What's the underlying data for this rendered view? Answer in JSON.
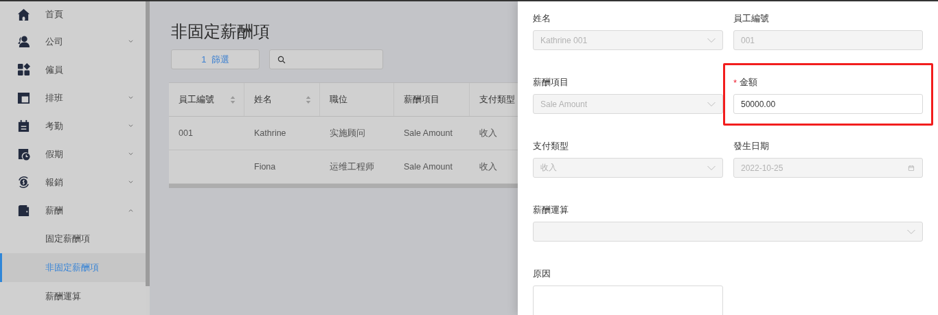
{
  "sidebar": {
    "items": [
      {
        "label": "首頁"
      },
      {
        "label": "公司",
        "expanded": false
      },
      {
        "label": "僱員"
      },
      {
        "label": "排班",
        "expanded": false
      },
      {
        "label": "考勤",
        "expanded": false
      },
      {
        "label": "假期",
        "expanded": false
      },
      {
        "label": "報銷",
        "expanded": false
      },
      {
        "label": "薪酬",
        "expanded": true,
        "children": [
          {
            "label": "固定薪酬項",
            "selected": false
          },
          {
            "label": "非固定薪酬項",
            "selected": true
          },
          {
            "label": "薪酬運算",
            "selected": false
          }
        ]
      }
    ]
  },
  "page": {
    "title": "非固定薪酬項",
    "filter_button": {
      "count": "1",
      "label": "篩選"
    }
  },
  "table": {
    "columns": [
      {
        "label": "員工編號",
        "sortable": true
      },
      {
        "label": "姓名",
        "sortable": true
      },
      {
        "label": "職位",
        "sortable": false
      },
      {
        "label": "薪酬項目",
        "sortable": false
      },
      {
        "label": "支付類型"
      }
    ],
    "rows": [
      [
        "001",
        "Kathrine",
        "实施顾问",
        "Sale Amount",
        "收入"
      ],
      [
        "",
        "Fiona",
        "运维工程师",
        "Sale Amount",
        "收入"
      ]
    ]
  },
  "form": {
    "fields": [
      {
        "label": "姓名",
        "kind": "select",
        "value": "Kathrine 001",
        "disabled": true,
        "highlighted": false,
        "wide": false
      },
      {
        "label": "員工編號",
        "kind": "input",
        "value": "001",
        "disabled": true,
        "highlighted": false,
        "wide": false
      },
      {
        "label": "薪酬項目",
        "kind": "select",
        "value": "Sale Amount",
        "disabled": true,
        "highlighted": false,
        "wide": false
      },
      {
        "label": "金額",
        "required_mark": "*",
        "kind": "input",
        "value": "50000.00",
        "disabled": false,
        "highlighted": true,
        "wide": false
      },
      {
        "label": "支付類型",
        "kind": "select",
        "value": "收入",
        "disabled": true,
        "highlighted": false,
        "wide": false
      },
      {
        "label": "發生日期",
        "kind": "date",
        "value": "2022-10-25",
        "disabled": true,
        "highlighted": false,
        "wide": false
      },
      {
        "label": "薪酬運算",
        "kind": "select",
        "disabled": true,
        "highlighted": false,
        "wide": true
      },
      {
        "label": "原因",
        "kind": "textarea",
        "wide": false
      }
    ]
  }
}
